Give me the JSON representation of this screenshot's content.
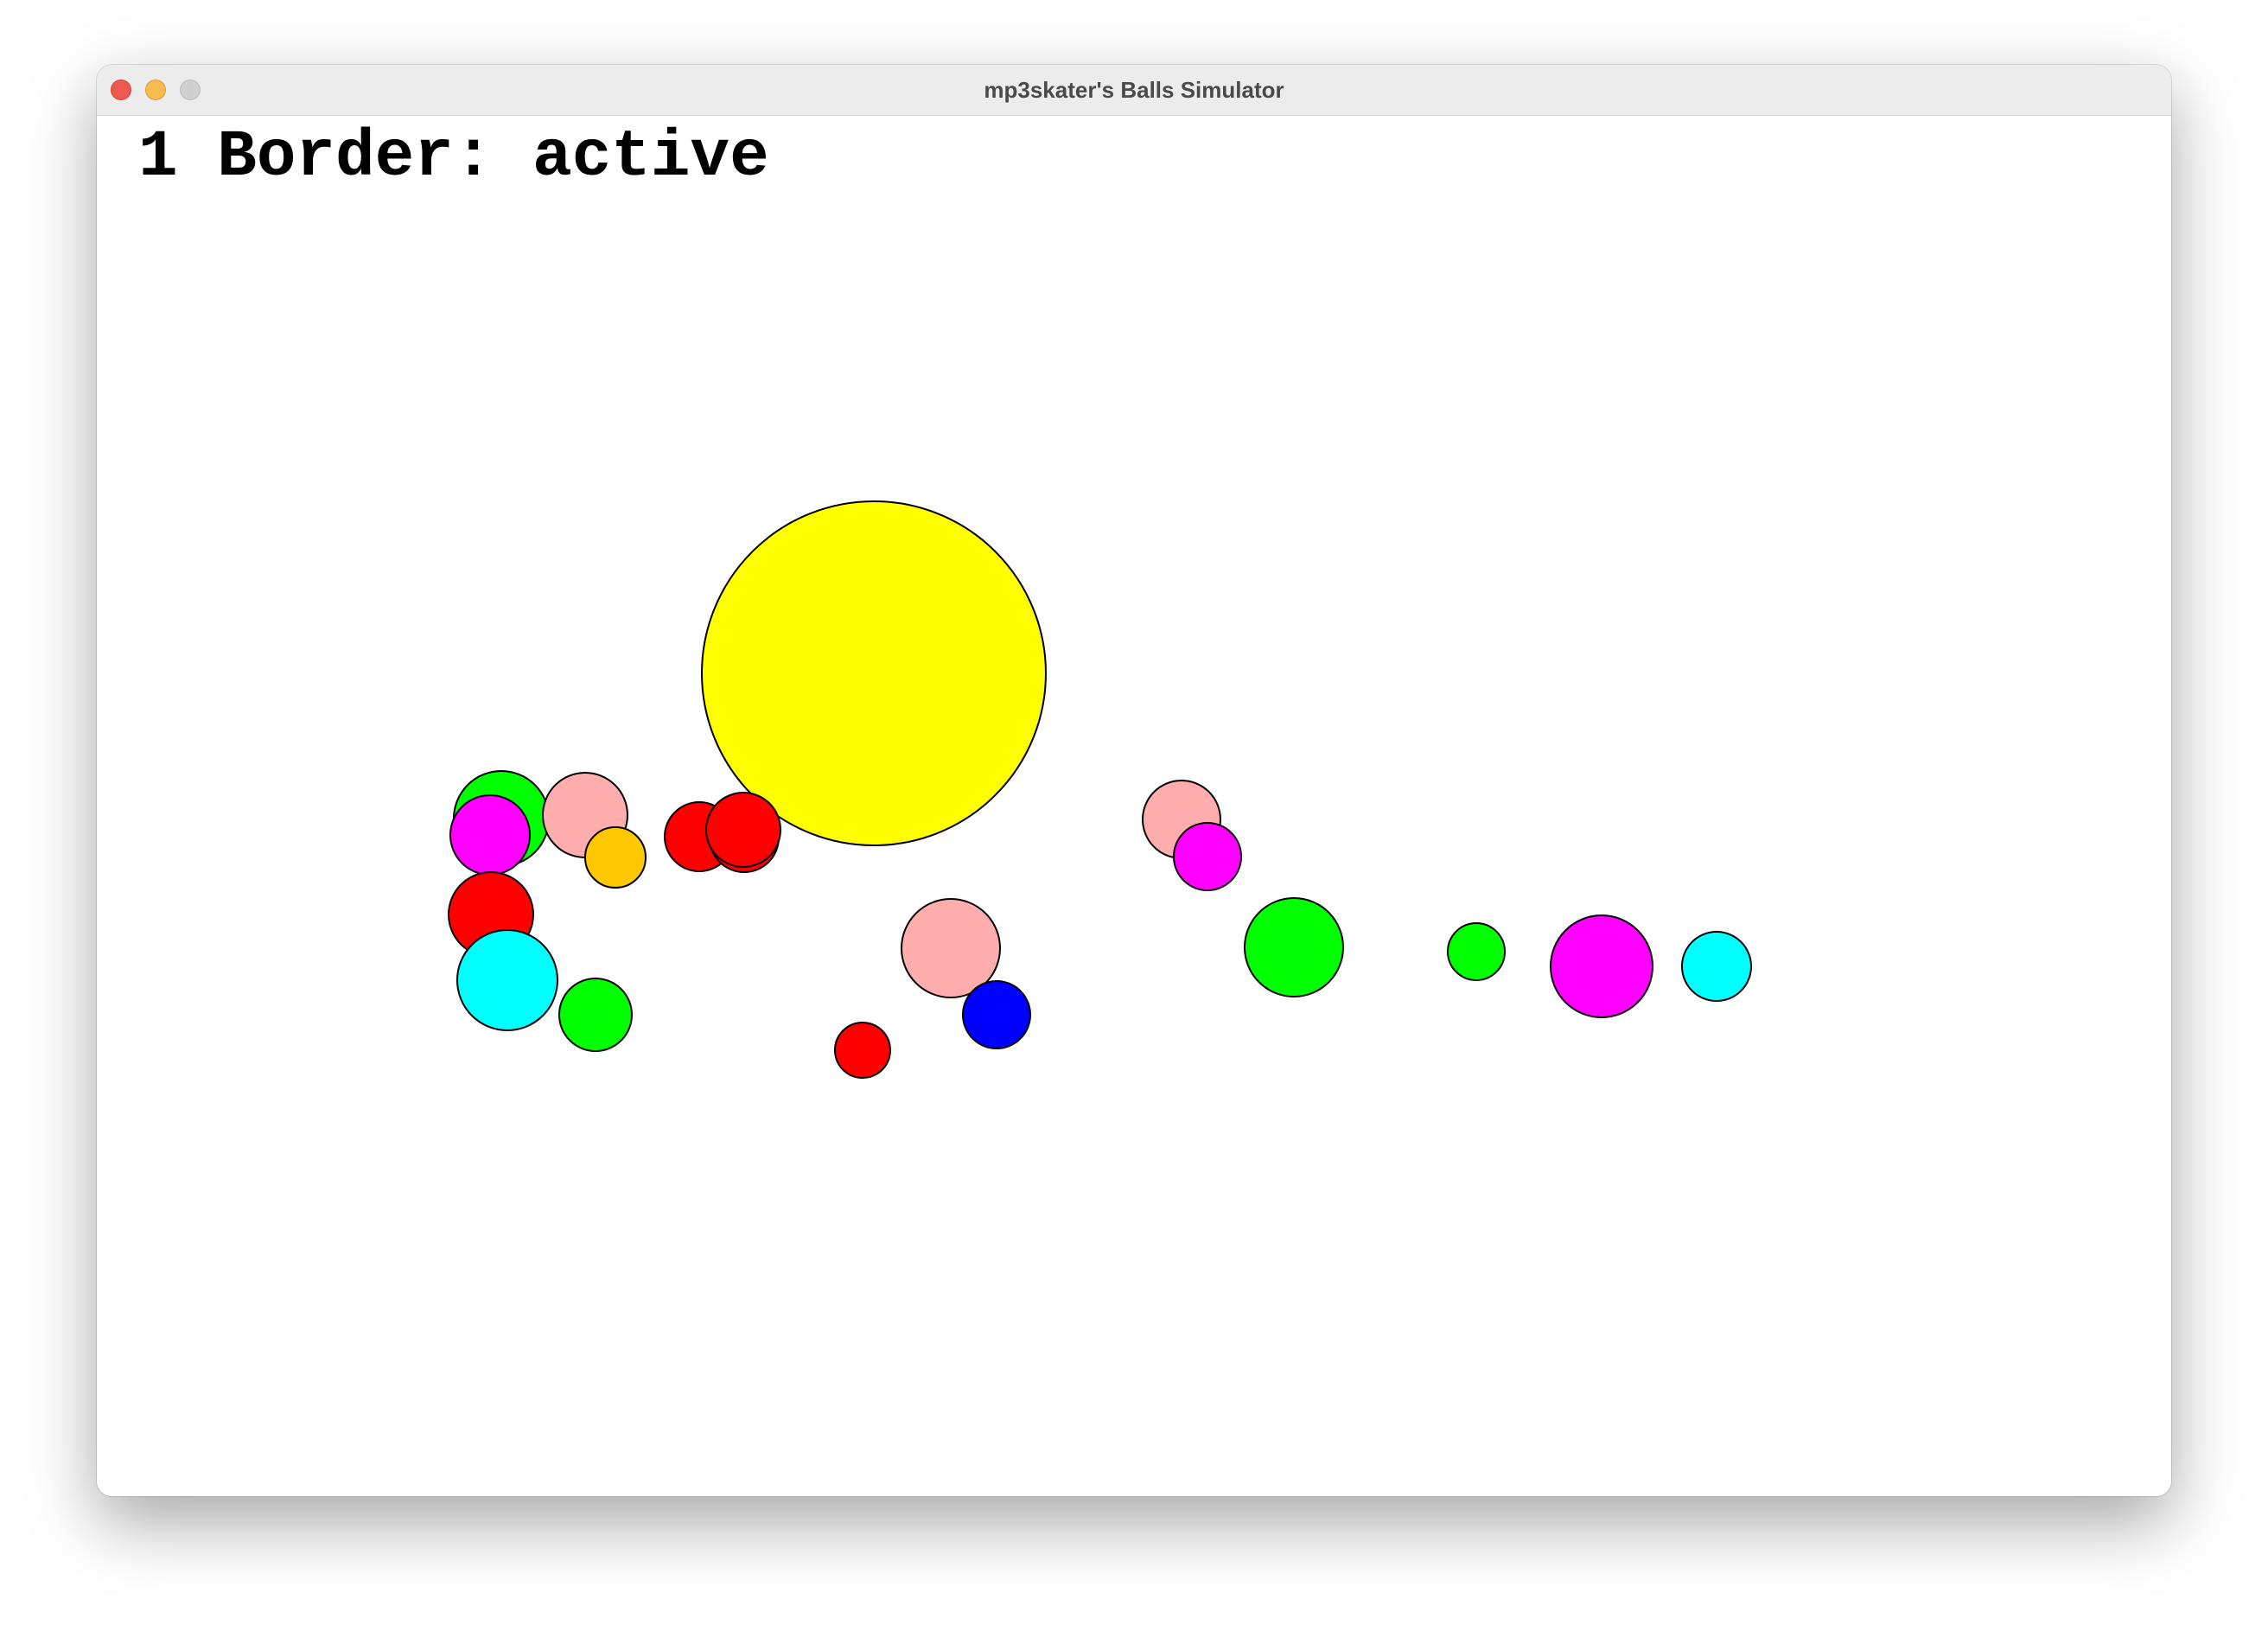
{
  "window": {
    "title": "mp3skater's Balls Simulator"
  },
  "status": {
    "text": "1 Border: active"
  },
  "colors": {
    "yellow": "#ffff00",
    "green": "#00ff00",
    "pink": "#ffadad",
    "magenta": "#ff00ff",
    "orange": "#ffc800",
    "red": "#ff0000",
    "cyan": "#00ffff",
    "blue": "#0000ff",
    "outline": "#000000"
  },
  "balls": [
    {
      "color": "yellow"
    },
    {
      "color": "green"
    },
    {
      "color": "pink"
    },
    {
      "color": "magenta"
    },
    {
      "color": "orange"
    },
    {
      "color": "red"
    },
    {
      "color": "red"
    },
    {
      "color": "red"
    },
    {
      "color": "red"
    },
    {
      "color": "cyan"
    },
    {
      "color": "green"
    },
    {
      "color": "pink"
    },
    {
      "color": "blue"
    },
    {
      "color": "red"
    },
    {
      "color": "pink"
    },
    {
      "color": "magenta"
    },
    {
      "color": "green"
    },
    {
      "color": "green"
    },
    {
      "color": "magenta"
    },
    {
      "color": "cyan"
    }
  ]
}
